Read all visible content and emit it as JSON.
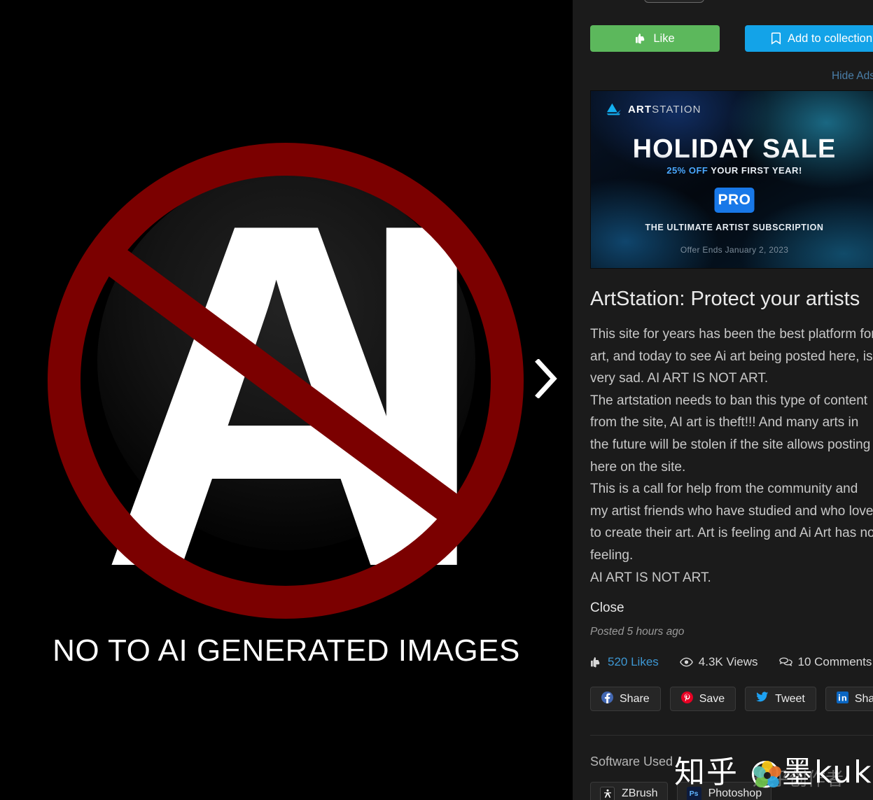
{
  "artwork": {
    "caption": "NO TO AI GENERATED IMAGES",
    "letters": {
      "a": "A",
      "i": "I"
    },
    "next_arrow_icon": "chevron-right-icon",
    "colors": {
      "sign_red": "#7b0000",
      "background": "#000000",
      "letter": "#ffffff"
    }
  },
  "sidebar": {
    "actions": {
      "like_label": "Like",
      "like_icon": "thumbs-up-icon",
      "like_color": "#5cb85c",
      "add_collection_label": "Add to collection",
      "add_collection_icon": "bookmark-icon",
      "add_collection_color": "#13a3e8"
    },
    "hide_ads_label": "Hide Ads",
    "ad": {
      "brand_bold": "ART",
      "brand_light": "STATION",
      "logo_icon": "artstation-logo-icon",
      "headline": "HOLIDAY SALE",
      "sub_percent": "25% OFF",
      "sub_rest": " YOUR FIRST YEAR!",
      "badge": "PRO",
      "tagline": "THE ULTIMATE ARTIST SUBSCRIPTION",
      "offer_ends": "Offer Ends January 2, 2023"
    },
    "post": {
      "title": "ArtStation: Protect your artists",
      "description": "This site for years has been the best platform for art, and today to see Ai art being posted here, is very sad. AI ART IS NOT ART.\nThe artstation needs to ban this type of content from the site, AI art is theft!!! And many arts in the future will be stolen if the site allows posting here on the site.\nThis is a call for help from the community and my artist friends who have studied and who love to create their art. Art is feeling and Ai Art has no feeling.\nAI ART IS NOT ART.",
      "close_label": "Close",
      "posted_time": "Posted 5 hours ago"
    },
    "stats": [
      {
        "icon": "thumbs-up-icon",
        "value": "520 Likes"
      },
      {
        "icon": "eye-icon",
        "value": "4.3K Views"
      },
      {
        "icon": "comment-icon",
        "value": "10 Comments"
      }
    ],
    "share_buttons": [
      {
        "icon": "facebook-icon",
        "label": "Share"
      },
      {
        "icon": "pinterest-icon",
        "label": "Save"
      },
      {
        "icon": "twitter-icon",
        "label": "Tweet"
      },
      {
        "icon": "linkedin-icon",
        "label": "Share"
      }
    ],
    "software": {
      "section_label": "Software Used",
      "items": [
        {
          "icon": "zbrush-icon",
          "icon_text": "",
          "label": "ZBrush"
        },
        {
          "icon": "photoshop-icon",
          "icon_text": "Ps",
          "label": "Photoshop"
        }
      ]
    }
  },
  "watermark": {
    "text": "知乎 @墨kuku",
    "sub": "知乎创作者",
    "flower_icon": "flower-logo-icon"
  }
}
